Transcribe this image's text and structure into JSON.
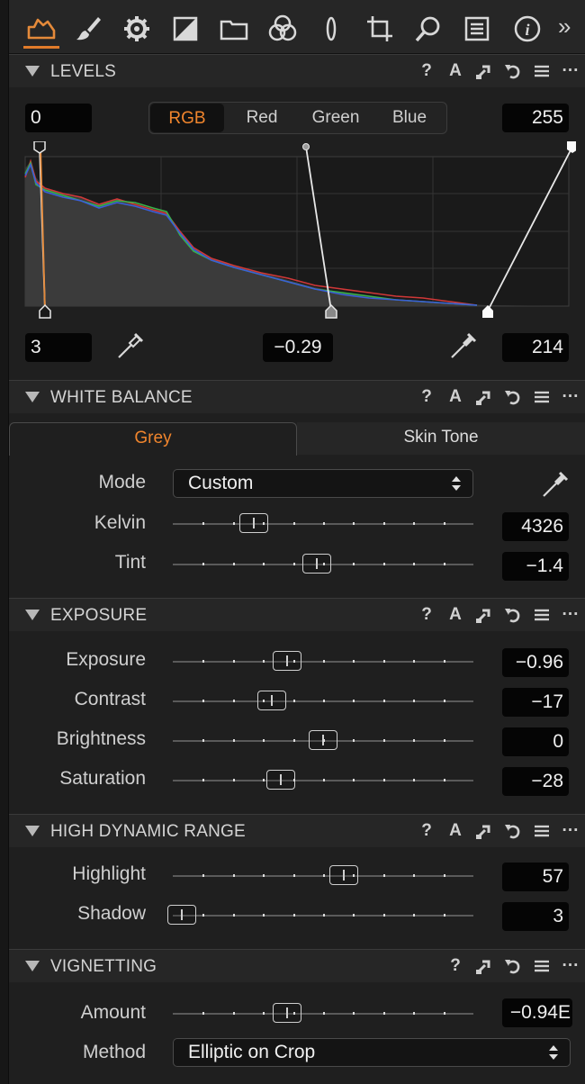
{
  "toolbar": {
    "tabs": [
      {
        "name": "base-characteristics-tab-icon"
      },
      {
        "name": "brush-icon"
      },
      {
        "name": "gear-icon"
      },
      {
        "name": "exposure-icon"
      },
      {
        "name": "folder-icon"
      },
      {
        "name": "color-icon"
      },
      {
        "name": "lens-icon"
      },
      {
        "name": "crop-icon"
      },
      {
        "name": "search-icon"
      },
      {
        "name": "metadata-icon"
      },
      {
        "name": "info-icon"
      }
    ],
    "more": "»",
    "accent": "#e07b2a"
  },
  "levels": {
    "title": "LEVELS",
    "input_left": "0",
    "input_right": "255",
    "channels": [
      "RGB",
      "Red",
      "Green",
      "Blue"
    ],
    "selected_channel": "RGB",
    "output_left": "3",
    "midtone": "−0.29",
    "output_right": "214",
    "header_icons": [
      "?",
      "A",
      "⤢",
      "↶",
      "≡",
      "···"
    ]
  },
  "white_balance": {
    "title": "WHITE BALANCE",
    "tabs": [
      "Grey",
      "Skin Tone"
    ],
    "active_tab": "Grey",
    "mode_label": "Mode",
    "mode_value": "Custom",
    "kelvin_label": "Kelvin",
    "kelvin_value": "4326",
    "kelvin_pos": 0.27,
    "tint_label": "Tint",
    "tint_value": "−1.4",
    "tint_pos": 0.48
  },
  "exposure": {
    "title": "EXPOSURE",
    "rows": [
      {
        "label": "Exposure",
        "value": "−0.96",
        "pos": 0.38
      },
      {
        "label": "Contrast",
        "value": "−17",
        "pos": 0.33
      },
      {
        "label": "Brightness",
        "value": "0",
        "pos": 0.5
      },
      {
        "label": "Saturation",
        "value": "−28",
        "pos": 0.36
      }
    ]
  },
  "hdr": {
    "title": "HIGH DYNAMIC RANGE",
    "rows": [
      {
        "label": "Highlight",
        "value": "57",
        "pos": 0.57
      },
      {
        "label": "Shadow",
        "value": "3",
        "pos": 0.03
      }
    ]
  },
  "vignetting": {
    "title": "VIGNETTING",
    "amount_label": "Amount",
    "amount_value": "−0.94E",
    "amount_pos": 0.38,
    "method_label": "Method",
    "method_value": "Elliptic on Crop"
  }
}
